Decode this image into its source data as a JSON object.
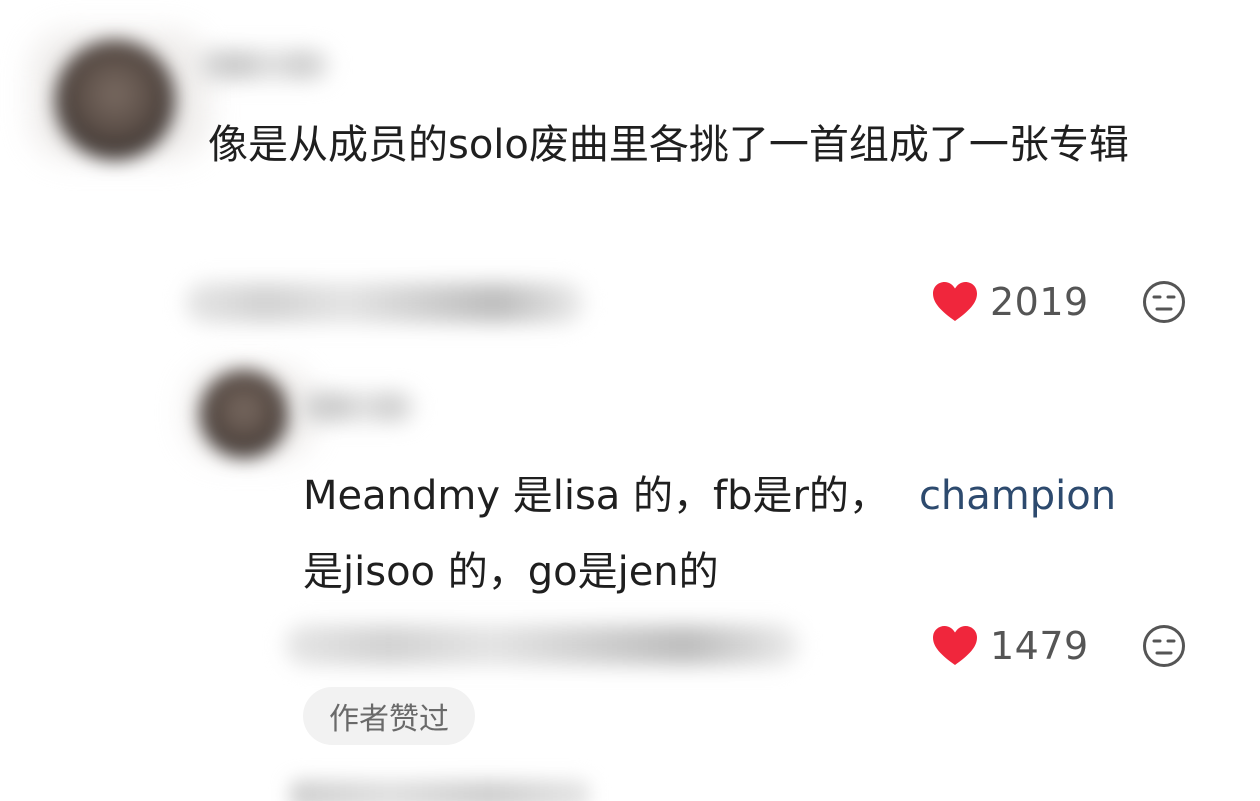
{
  "comments": [
    {
      "text": "像是从成员的solo废曲里各挑了一首组成了一张专辑",
      "likes": "2019",
      "heart_color": "#f0263c"
    },
    {
      "text_prefix": "Meandmy 是lisa 的，fb是r的，",
      "mention": "champion",
      "text_suffix": "是jisoo 的，go是jen的",
      "likes": "1479",
      "heart_color": "#f0263c",
      "badge": "作者赞过"
    }
  ],
  "icons": {
    "like": "heart-icon",
    "dislike": "neutral-face-icon"
  }
}
